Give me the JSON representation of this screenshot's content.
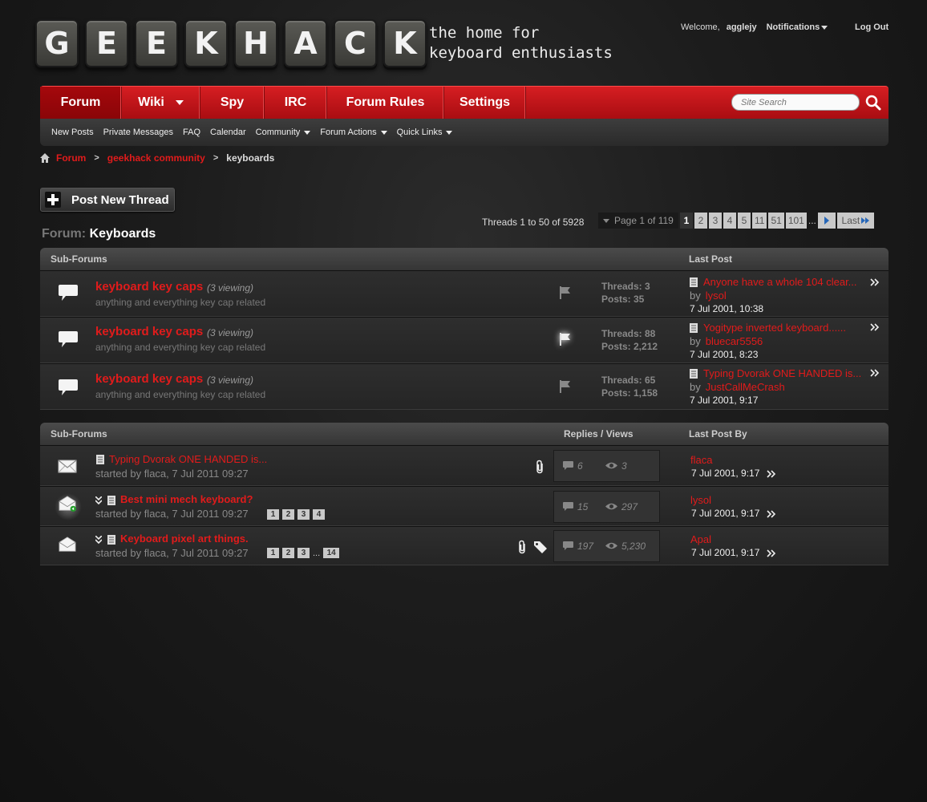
{
  "header": {
    "logo_letters": [
      "G",
      "E",
      "E",
      "K",
      "H",
      "A",
      "C",
      "K"
    ],
    "tagline_line1": "the home for",
    "tagline_line2": "keyboard enthusiasts",
    "welcome": "Welcome,",
    "username": "agglejy",
    "notifications": "Notifications",
    "logout": "Log Out"
  },
  "nav": {
    "tabs": [
      "Forum",
      "Wiki",
      "Spy",
      "IRC",
      "Forum Rules",
      "Settings"
    ],
    "active": "Forum",
    "search_placeholder": "Site Search"
  },
  "subnav": {
    "items": [
      "New Posts",
      "Private Messages",
      "FAQ",
      "Calendar",
      "Community",
      "Forum Actions",
      "Quick Links"
    ]
  },
  "breadcrumb": {
    "home": "Forum",
    "community": "geekhack community",
    "current": "keyboards"
  },
  "post_thread_label": "Post New Thread",
  "forum_title": {
    "prefix": "Forum:",
    "name": "Keyboards"
  },
  "pagination": {
    "thread_count": "Threads 1 to 50 of 5928",
    "page_of": "Page 1 of 119",
    "pages": [
      "1",
      "2",
      "3",
      "4",
      "5",
      "11",
      "51",
      "101"
    ],
    "current": "1",
    "dots": "...",
    "last": "Last"
  },
  "subforums": {
    "header_left": "Sub-Forums",
    "header_right": "Last Post",
    "rows": [
      {
        "title": "keyboard key caps",
        "viewing": "(3 viewing)",
        "desc": "anything and everything key cap related",
        "threads": "Threads: 3",
        "posts": "Posts: 35",
        "last_title": "Anyone have a whole 104 clear...",
        "by": "by",
        "last_user": "lysol",
        "last_date": "7 Jul 2001, 10:38"
      },
      {
        "title": "keyboard key caps",
        "viewing": "(3 viewing)",
        "desc": "anything and everything key cap related",
        "threads": "Threads: 88",
        "posts": "Posts: 2,212",
        "last_title": "Yogitype inverted keyboard......",
        "by": "by",
        "last_user": "bluecar5556",
        "last_date": "7 Jul 2001, 8:23"
      },
      {
        "title": "keyboard key caps",
        "viewing": "(3 viewing)",
        "desc": "anything and everything key cap related",
        "threads": "Threads: 65",
        "posts": "Posts: 1,158",
        "last_title": "Typing Dvorak ONE HANDED is...",
        "by": "by",
        "last_user": "JustCallMeCrash",
        "last_date": "7 Jul 2001, 9:17"
      }
    ]
  },
  "threads": {
    "header_left": "Sub-Forums",
    "header_mid": "Replies / Views",
    "header_right": "Last Post By",
    "rows": [
      {
        "title": "Typing Dvorak ONE HANDED is...",
        "meta": "started by flaca, 7 Jul 2011 09:27",
        "replies": "6",
        "views": "3",
        "last_user": "flaca",
        "last_date": "7 Jul 2001, 9:17"
      },
      {
        "title": "Best mini mech keyboard?",
        "meta": "started by flaca, 7 Jul 2011 09:27",
        "pages": [
          "1",
          "2",
          "3",
          "4"
        ],
        "replies": "15",
        "views": "297",
        "last_user": "lysol",
        "last_date": "7 Jul 2001, 9:17"
      },
      {
        "title": "Keyboard pixel art things.",
        "meta": "started by flaca, 7 Jul 2011 09:27",
        "pages": [
          "1",
          "2",
          "3"
        ],
        "pages_dots": "...",
        "pages_last": "14",
        "replies": "197",
        "views": "5,230",
        "last_user": "Apal",
        "last_date": "7 Jul 2001, 9:17"
      }
    ]
  },
  "colors": {
    "accent_red": "#e11b1b",
    "nav_red": "#c8151a"
  }
}
